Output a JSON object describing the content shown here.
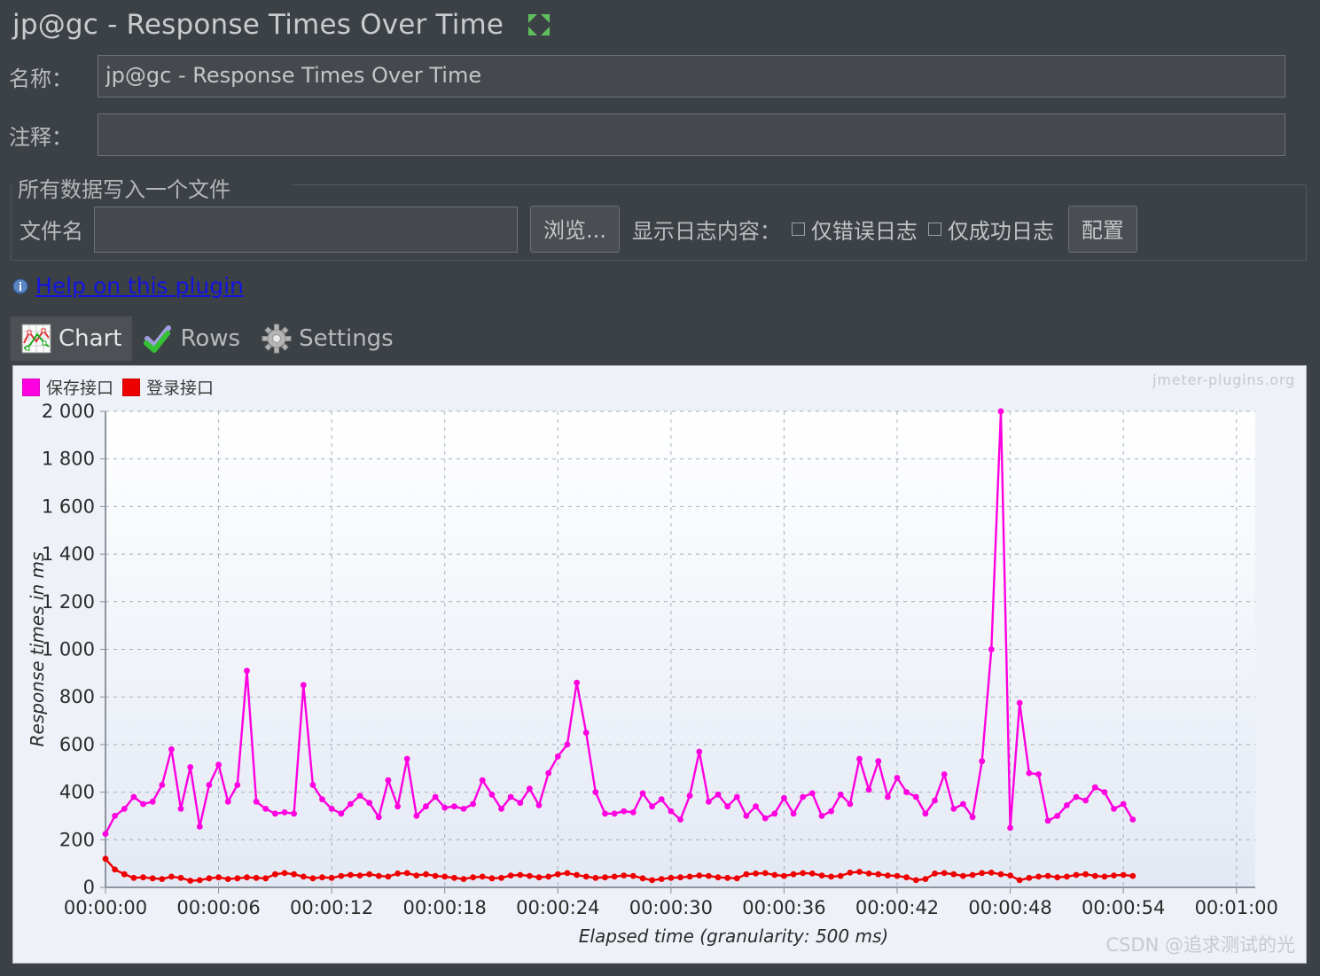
{
  "window": {
    "title": "jp@gc - Response Times Over Time",
    "expand_icon": "expand-arrows-icon"
  },
  "form": {
    "name_label": "名称：",
    "name_value": "jp@gc - Response Times Over Time",
    "comment_label": "注释：",
    "comment_value": "",
    "comment_placeholder": ""
  },
  "filegroup": {
    "group_title": "所有数据写入一个文件",
    "filename_label": "文件名",
    "filename_value": "",
    "filename_placeholder": "",
    "browse_label": "浏览...",
    "log_content_label": "显示日志内容：",
    "errors_only_label": "仅错误日志",
    "errors_only_checked": false,
    "success_only_label": "仅成功日志",
    "success_only_checked": false,
    "configure_label": "配置"
  },
  "help": {
    "icon": "info-icon",
    "link_text": "Help on this plugin",
    "link_color": "#1414e0"
  },
  "tabs": [
    {
      "label": "Chart",
      "icon": "chart-line-icon",
      "active": true
    },
    {
      "label": "Rows",
      "icon": "double-check-icon",
      "active": false
    },
    {
      "label": "Settings",
      "icon": "gear-icon",
      "active": false
    }
  ],
  "chart_panel": {
    "watermark": "jmeter-plugins.org",
    "csdn_watermark": "CSDN @追求测试的光"
  },
  "chart_data": {
    "type": "line",
    "title": "",
    "xlabel": "Elapsed time (granularity: 500 ms)",
    "ylabel": "Response times in ms",
    "ylim": [
      0,
      2000
    ],
    "yticks": [
      0,
      200,
      400,
      600,
      800,
      1000,
      1200,
      1400,
      1600,
      1800,
      2000
    ],
    "ytick_labels": [
      "0",
      "200",
      "400",
      "600",
      "800",
      "1 000",
      "1 200",
      "1 400",
      "1 600",
      "1 800",
      "2 000"
    ],
    "xlim": [
      0,
      61
    ],
    "xticks": [
      0,
      6,
      12,
      18,
      24,
      30,
      36,
      42,
      48,
      54,
      60
    ],
    "xtick_labels": [
      "00:00:00",
      "00:00:06",
      "00:00:12",
      "00:00:18",
      "00:00:24",
      "00:00:30",
      "00:00:36",
      "00:00:42",
      "00:00:48",
      "00:00:54",
      "00:01:00"
    ],
    "grid": true,
    "legend_position": "top-left",
    "x_step_seconds": 0.5,
    "series": [
      {
        "name": "保存接口",
        "color": "#FF00E0",
        "values": [
          225,
          300,
          330,
          380,
          350,
          360,
          430,
          580,
          330,
          505,
          255,
          430,
          515,
          360,
          430,
          910,
          360,
          330,
          310,
          315,
          310,
          850,
          430,
          370,
          330,
          310,
          350,
          385,
          355,
          295,
          450,
          340,
          540,
          300,
          340,
          380,
          335,
          340,
          330,
          350,
          450,
          390,
          330,
          380,
          355,
          415,
          345,
          480,
          550,
          600,
          860,
          650,
          400,
          310,
          310,
          320,
          315,
          395,
          340,
          370,
          320,
          285,
          385,
          570,
          360,
          390,
          340,
          380,
          300,
          340,
          290,
          310,
          375,
          310,
          380,
          395,
          300,
          320,
          390,
          350,
          540,
          410,
          530,
          380,
          460,
          400,
          380,
          310,
          365,
          475,
          330,
          350,
          295,
          530,
          1000,
          2000,
          250,
          775,
          480,
          475,
          280,
          300,
          345,
          380,
          365,
          420,
          400,
          330,
          350,
          285
        ]
      },
      {
        "name": "登录接口",
        "color": "#EE0000",
        "values": [
          120,
          75,
          55,
          40,
          42,
          38,
          35,
          45,
          40,
          28,
          30,
          38,
          42,
          35,
          38,
          42,
          40,
          38,
          55,
          60,
          55,
          45,
          38,
          42,
          40,
          48,
          52,
          50,
          55,
          48,
          45,
          58,
          60,
          50,
          55,
          48,
          45,
          40,
          35,
          42,
          45,
          38,
          40,
          50,
          52,
          48,
          42,
          45,
          55,
          60,
          52,
          45,
          40,
          42,
          45,
          50,
          48,
          38,
          30,
          35,
          40,
          42,
          45,
          50,
          48,
          42,
          40,
          38,
          55,
          58,
          60,
          52,
          48,
          55,
          60,
          58,
          50,
          45,
          48,
          62,
          65,
          58,
          55,
          50,
          48,
          42,
          30,
          35,
          58,
          60,
          55,
          48,
          52,
          60,
          62,
          55,
          50,
          30,
          40,
          45,
          48,
          42,
          45,
          52,
          55,
          48,
          45,
          50,
          52,
          48
        ]
      }
    ]
  }
}
